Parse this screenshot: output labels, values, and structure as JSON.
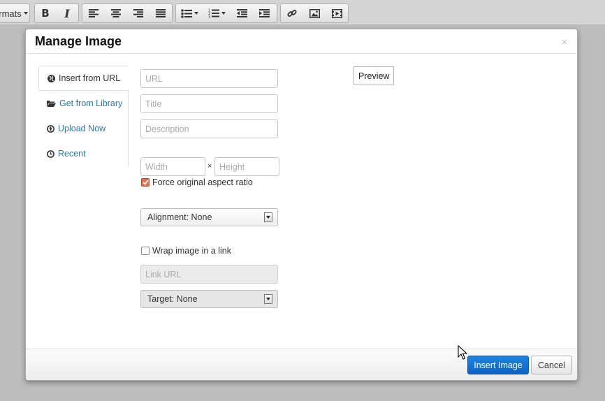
{
  "toolbar": {
    "formats_label": "rmats",
    "bold_label": "B",
    "italic_label": "I",
    "icons": [
      "bold-icon",
      "italic-icon",
      "align-left-icon",
      "align-center-icon",
      "align-right-icon",
      "align-justify-icon",
      "bullet-list-icon",
      "numbered-list-icon",
      "outdent-icon",
      "indent-icon",
      "link-icon",
      "image-icon",
      "media-icon"
    ]
  },
  "modal": {
    "title": "Manage Image",
    "close_symbol": "×",
    "tabs": [
      {
        "label": "Insert from URL",
        "icon": "globe-icon",
        "active": true
      },
      {
        "label": "Get from Library",
        "icon": "folder-open-icon",
        "active": false
      },
      {
        "label": "Upload Now",
        "icon": "upload-icon",
        "active": false
      },
      {
        "label": "Recent",
        "icon": "clock-icon",
        "active": false
      }
    ],
    "form": {
      "url_placeholder": "URL",
      "title_placeholder": "Title",
      "description_placeholder": "Description",
      "width_placeholder": "Width",
      "times_symbol": "×",
      "height_placeholder": "Height",
      "aspect_label": "Force original aspect ratio",
      "aspect_checked": true,
      "alignment_label": "Alignment: None",
      "wrap_label": "Wrap image in a link",
      "wrap_checked": false,
      "link_url_placeholder": "Link URL",
      "target_label": "Target: None"
    },
    "preview_label": "Preview",
    "footer": {
      "insert_label": "Insert Image",
      "cancel_label": "Cancel"
    }
  },
  "colors": {
    "primary": "#0b62c4",
    "link": "#1f7bb3",
    "checkbox_checked": "#e0714c"
  }
}
